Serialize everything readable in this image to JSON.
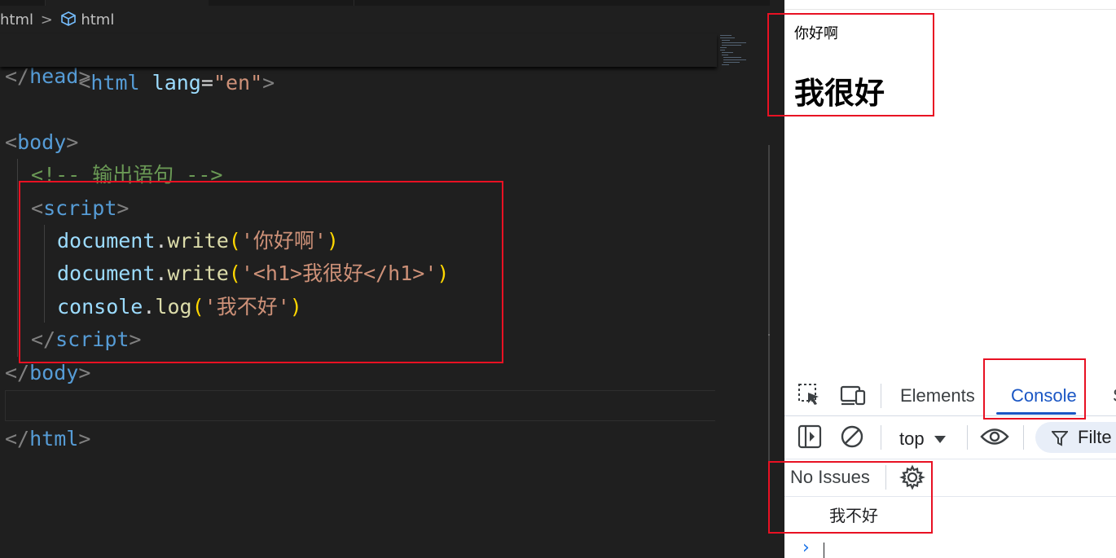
{
  "editor": {
    "breadcrumb": {
      "file": "html",
      "separator": ">",
      "symbol": "html"
    },
    "code": {
      "html_open": {
        "tag": "html",
        "attr": "lang",
        "eq": "=",
        "value": "\"en\""
      },
      "head_close": "head",
      "body_open": "body",
      "comment": "<!-- 输出语句 -->",
      "script_open": "script",
      "line1": {
        "obj": "document",
        "method": "write",
        "arg": "'你好啊'"
      },
      "line2": {
        "obj": "document",
        "method": "write",
        "arg": "'<h1>我很好</h1>'"
      },
      "line3": {
        "obj": "console",
        "method": "log",
        "arg": "'我不好'"
      },
      "script_close": "script",
      "body_close": "body",
      "html_close": "html"
    }
  },
  "browser": {
    "page": {
      "paragraph": "你好啊",
      "heading": "我很好"
    },
    "devtools": {
      "tabs": [
        "Elements",
        "Console",
        "S"
      ],
      "active_tab": "Console",
      "context_select": "top",
      "filter_placeholder": "Filte",
      "issues": "No Issues",
      "console_messages": [
        "我不好"
      ]
    }
  },
  "colors": {
    "highlight_box": "#e81123",
    "devtools_accent": "#1a56c4"
  }
}
